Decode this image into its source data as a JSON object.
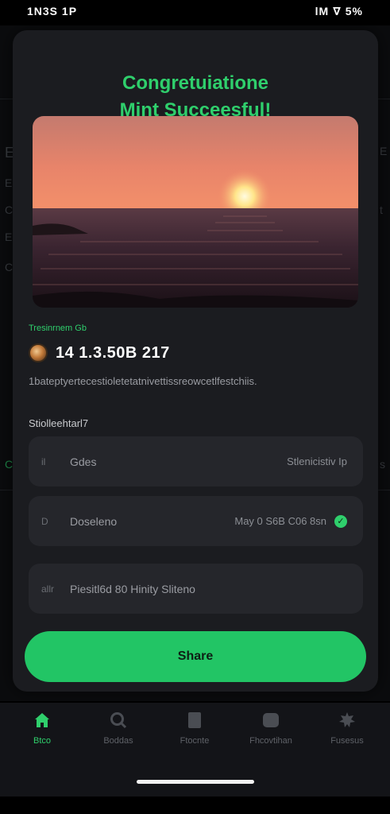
{
  "status_bar": {
    "time": "1N3S 1P",
    "indicators": "lM ∇ 5%"
  },
  "modal": {
    "title_line1": "Congretuiatione",
    "title_line2": "Mint Succeesful!",
    "collection_label": "Tresinrnem Gb",
    "token_id": "14 1.3.50B 217",
    "description": "1bateptyertecestioletetatnivettissreowcetlfestchiis.",
    "section_label": "Stiolleehtarl7",
    "details": [
      {
        "lead": "il",
        "key": "Gdes",
        "value": "Stlenicistiv Ip"
      },
      {
        "lead": "D",
        "key": "Doseleno",
        "value": "May 0 S6B C06 8sn"
      },
      {
        "lead": "allr",
        "key": "Piesitl6d 80 Hinity Sliteno",
        "value": ""
      }
    ],
    "share_label": "Share"
  },
  "tabs": [
    {
      "icon": "home-icon",
      "label": "Btco",
      "active": true
    },
    {
      "icon": "search-icon",
      "label": "Boddas",
      "active": false
    },
    {
      "icon": "wallet-icon",
      "label": "Ftocnte",
      "active": false
    },
    {
      "icon": "gallery-icon",
      "label": "Fhcovtihan",
      "active": false
    },
    {
      "icon": "settings-icon",
      "label": "Fusesus",
      "active": false
    }
  ],
  "colors": {
    "accent": "#22c565",
    "title_green": "#2fcf6c",
    "modal_bg": "#1b1c20",
    "card_bg": "#25262b"
  }
}
